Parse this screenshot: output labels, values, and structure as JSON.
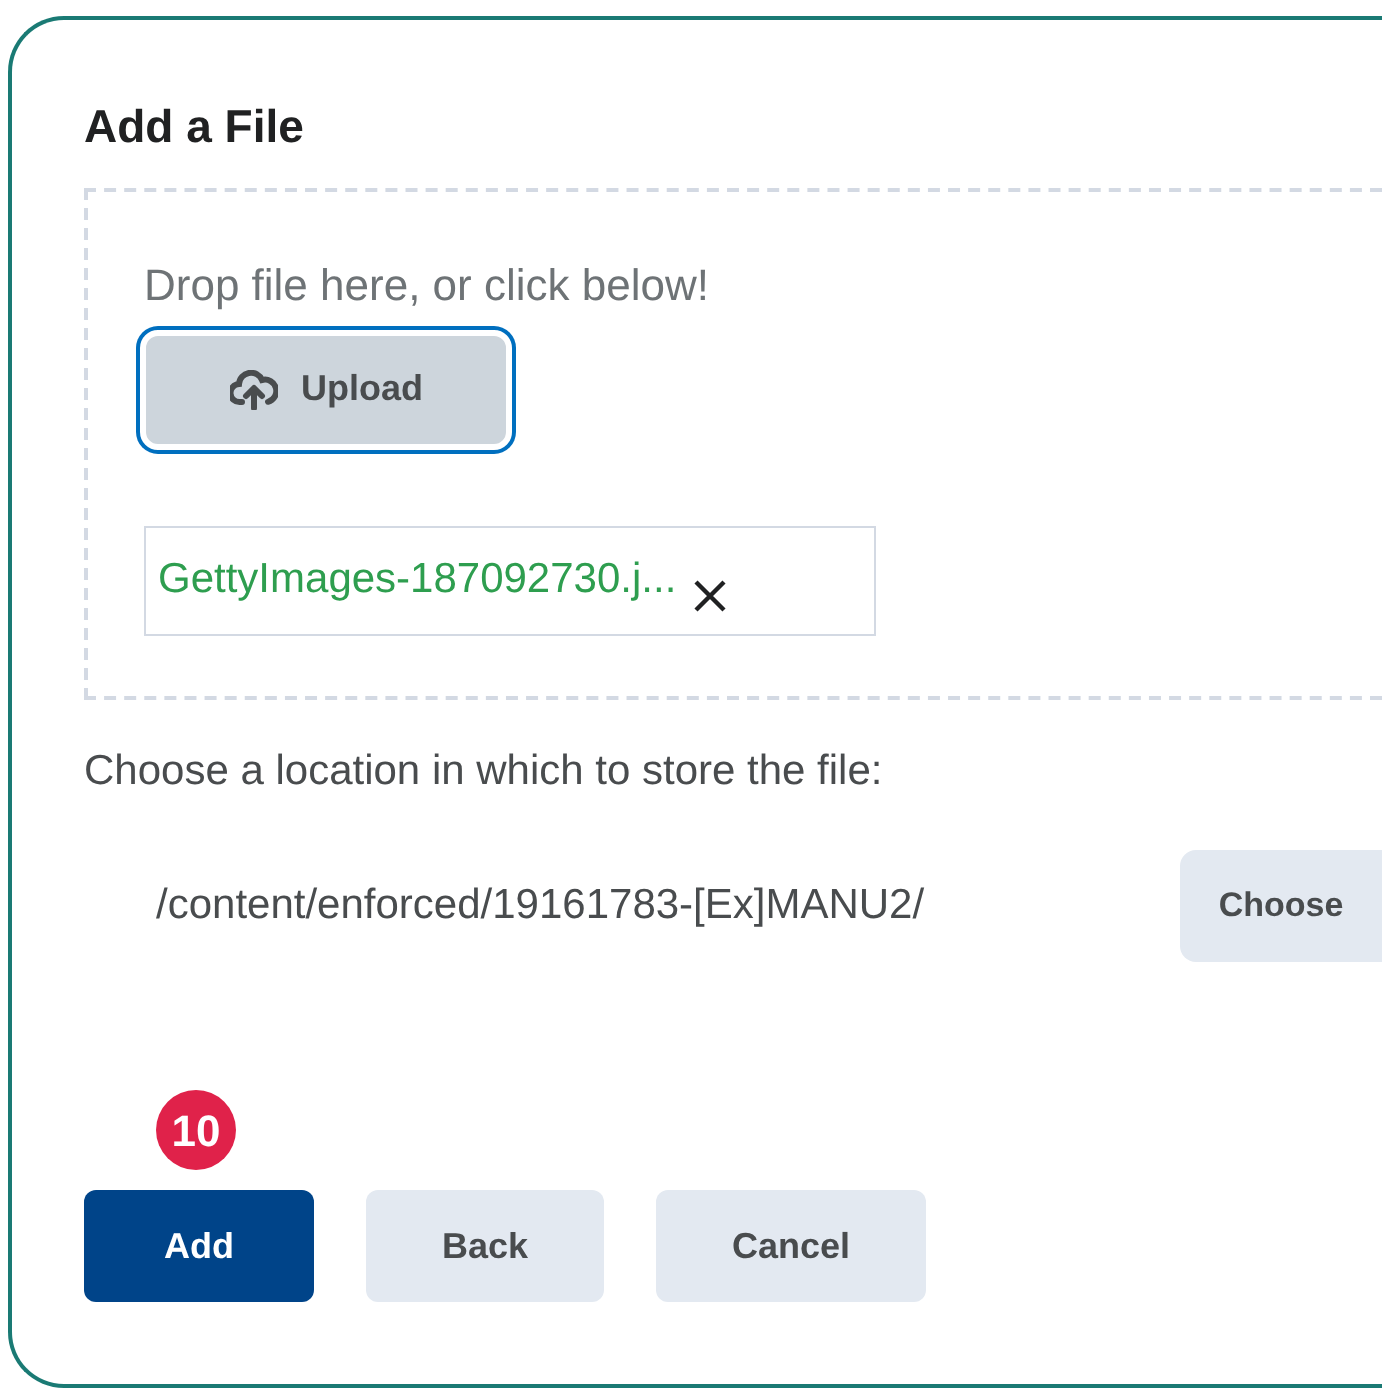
{
  "dialog": {
    "title": "Add a File"
  },
  "dropzone": {
    "prompt": "Drop file here, or click below!",
    "upload_button": "Upload",
    "file": {
      "name": "GettyImages-187092730.j..."
    }
  },
  "location": {
    "label": "Choose a location in which to store the file:",
    "path": "/content/enforced/19161783-[Ex]MANU2/",
    "choose_button": "Choose"
  },
  "step_badge": "10",
  "buttons": [
    {
      "label": "Add",
      "kind": "primary"
    },
    {
      "label": "Back",
      "kind": "secondary"
    },
    {
      "label": "Cancel",
      "kind": "secondary"
    }
  ]
}
